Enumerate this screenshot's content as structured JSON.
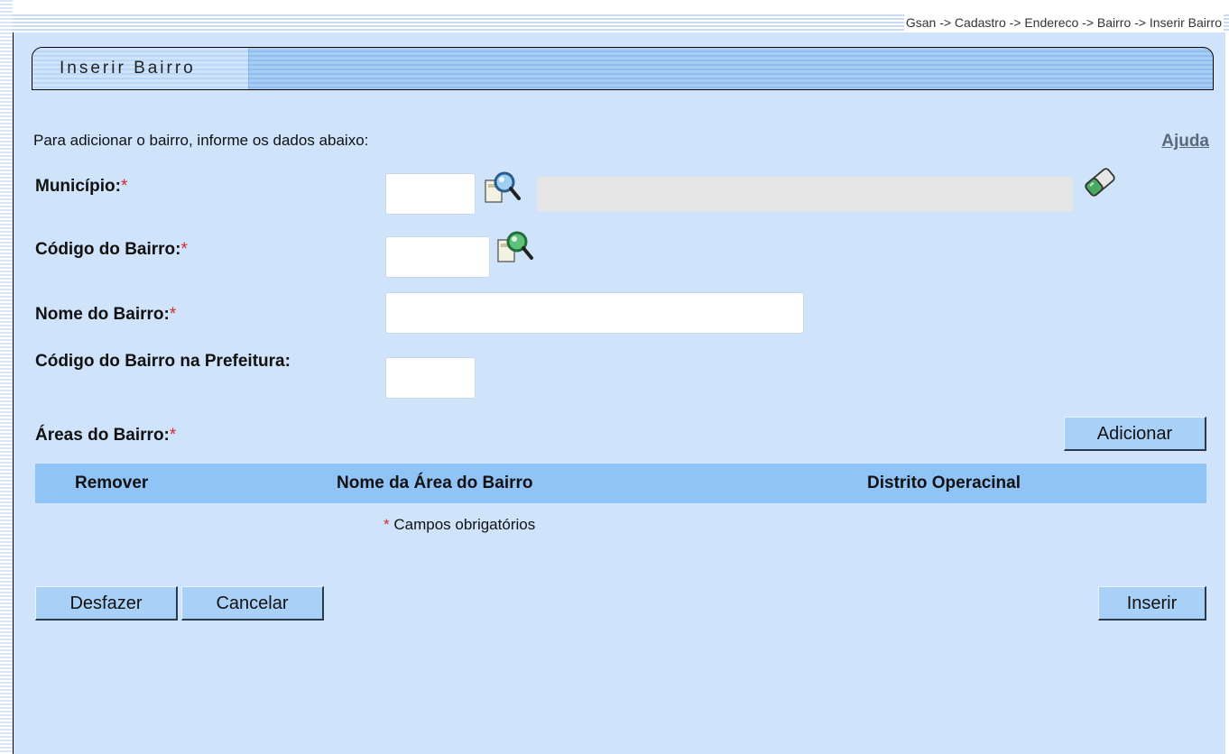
{
  "breadcrumb": "Gsan -> Cadastro -> Endereco -> Bairro -> Inserir Bairro",
  "page_title": "Inserir Bairro",
  "intro_text": "Para adicionar o bairro, informe os dados abaixo:",
  "help_link": "Ajuda",
  "fields": {
    "municipio_label": "Município:",
    "codigo_bairro_label": "Código do Bairro:",
    "nome_bairro_label": "Nome do Bairro:",
    "codigo_prefeitura_label": "Código do Bairro na Prefeitura:",
    "areas_label": "Áreas do Bairro:",
    "required_marker": "*"
  },
  "table": {
    "columns": [
      "Remover",
      "Nome da Área do Bairro",
      "Distrito Operacinal"
    ]
  },
  "mandatory_note": "Campos obrigatórios",
  "buttons": {
    "add": "Adicionar",
    "undo": "Desfazer",
    "cancel": "Cancelar",
    "insert": "Inserir"
  },
  "colors": {
    "panel_bg": "#cfe3fa",
    "table_header_bg": "#90c4f6",
    "button_bg": "#a9d1f7",
    "required": "#d62b2b"
  }
}
